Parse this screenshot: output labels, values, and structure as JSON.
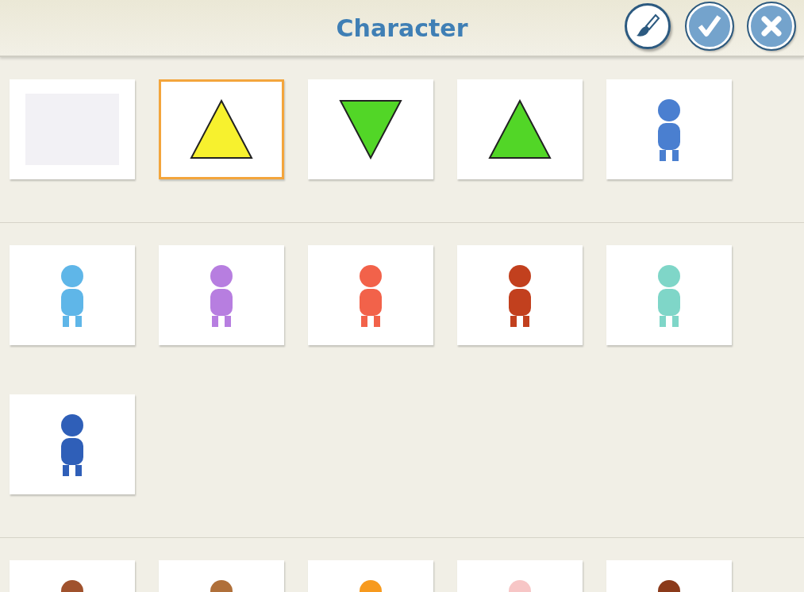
{
  "header": {
    "title": "Character"
  },
  "sections": [
    {
      "tiles": [
        {
          "kind": "blank",
          "selected": false
        },
        {
          "kind": "triangle-up",
          "selected": true,
          "color": "#f7f12e"
        },
        {
          "kind": "triangle-down",
          "selected": false,
          "color": "#52d627"
        },
        {
          "kind": "triangle-up",
          "selected": false,
          "color": "#52d627"
        },
        {
          "kind": "figure",
          "selected": false,
          "color": "#4a7fd0"
        }
      ]
    },
    {
      "tiles": [
        {
          "kind": "figure",
          "selected": false,
          "color": "#5fb6e8"
        },
        {
          "kind": "figure",
          "selected": false,
          "color": "#b77ee0"
        },
        {
          "kind": "figure",
          "selected": false,
          "color": "#f2624a"
        },
        {
          "kind": "figure",
          "selected": false,
          "color": "#c2401e"
        },
        {
          "kind": "figure",
          "selected": false,
          "color": "#7fd6c8"
        },
        {
          "kind": "figure",
          "selected": false,
          "color": "#2f5fb8"
        }
      ]
    },
    {
      "tiles": [
        {
          "kind": "figure",
          "selected": false,
          "color": "#a0522d"
        },
        {
          "kind": "figure",
          "selected": false,
          "color": "#b0703a"
        },
        {
          "kind": "figure",
          "selected": false,
          "color": "#f79a1e"
        },
        {
          "kind": "figure",
          "selected": false,
          "color": "#f7c6c6"
        },
        {
          "kind": "figure",
          "selected": false,
          "color": "#8b3a1a"
        }
      ]
    }
  ]
}
